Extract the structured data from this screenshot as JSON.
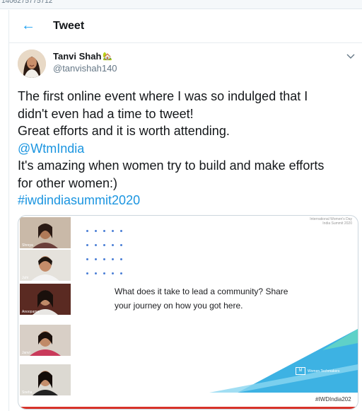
{
  "browser": {
    "url_fragment": "1406275775712"
  },
  "header": {
    "title": "Tweet",
    "back_label": "←"
  },
  "author": {
    "name": "Tanvi Shah",
    "emoji": "🏡",
    "handle": "@tanvishah140"
  },
  "tweet": {
    "lines": [
      "The first online event where I was so indulged that I",
      "didn't even had a time to tweet!",
      "Great efforts and it is worth attending."
    ],
    "mention": "@WtmIndia",
    "lines2": [
      "It's amazing when women try to build and make efforts",
      "for other women:)"
    ],
    "hashtag": "#iwdindiasummit2020"
  },
  "media": {
    "slide_header_line1": "International Women's Day",
    "slide_header_line2": "India Summit 2020",
    "question_line1": "What does it take to lead a community?  Share",
    "question_line2": "your journey on how you got here.",
    "brand": "Women Techmakers",
    "slide_hashtag": "#IWDIndia202",
    "participants": [
      "Shreya",
      "Juhi",
      "Anoopama",
      "Janvi",
      "Sneha"
    ]
  },
  "colors": {
    "link": "#1b95e0",
    "accent": "#1da1f2",
    "teal": "#3db2e3",
    "red_bar": "#d8332a"
  }
}
